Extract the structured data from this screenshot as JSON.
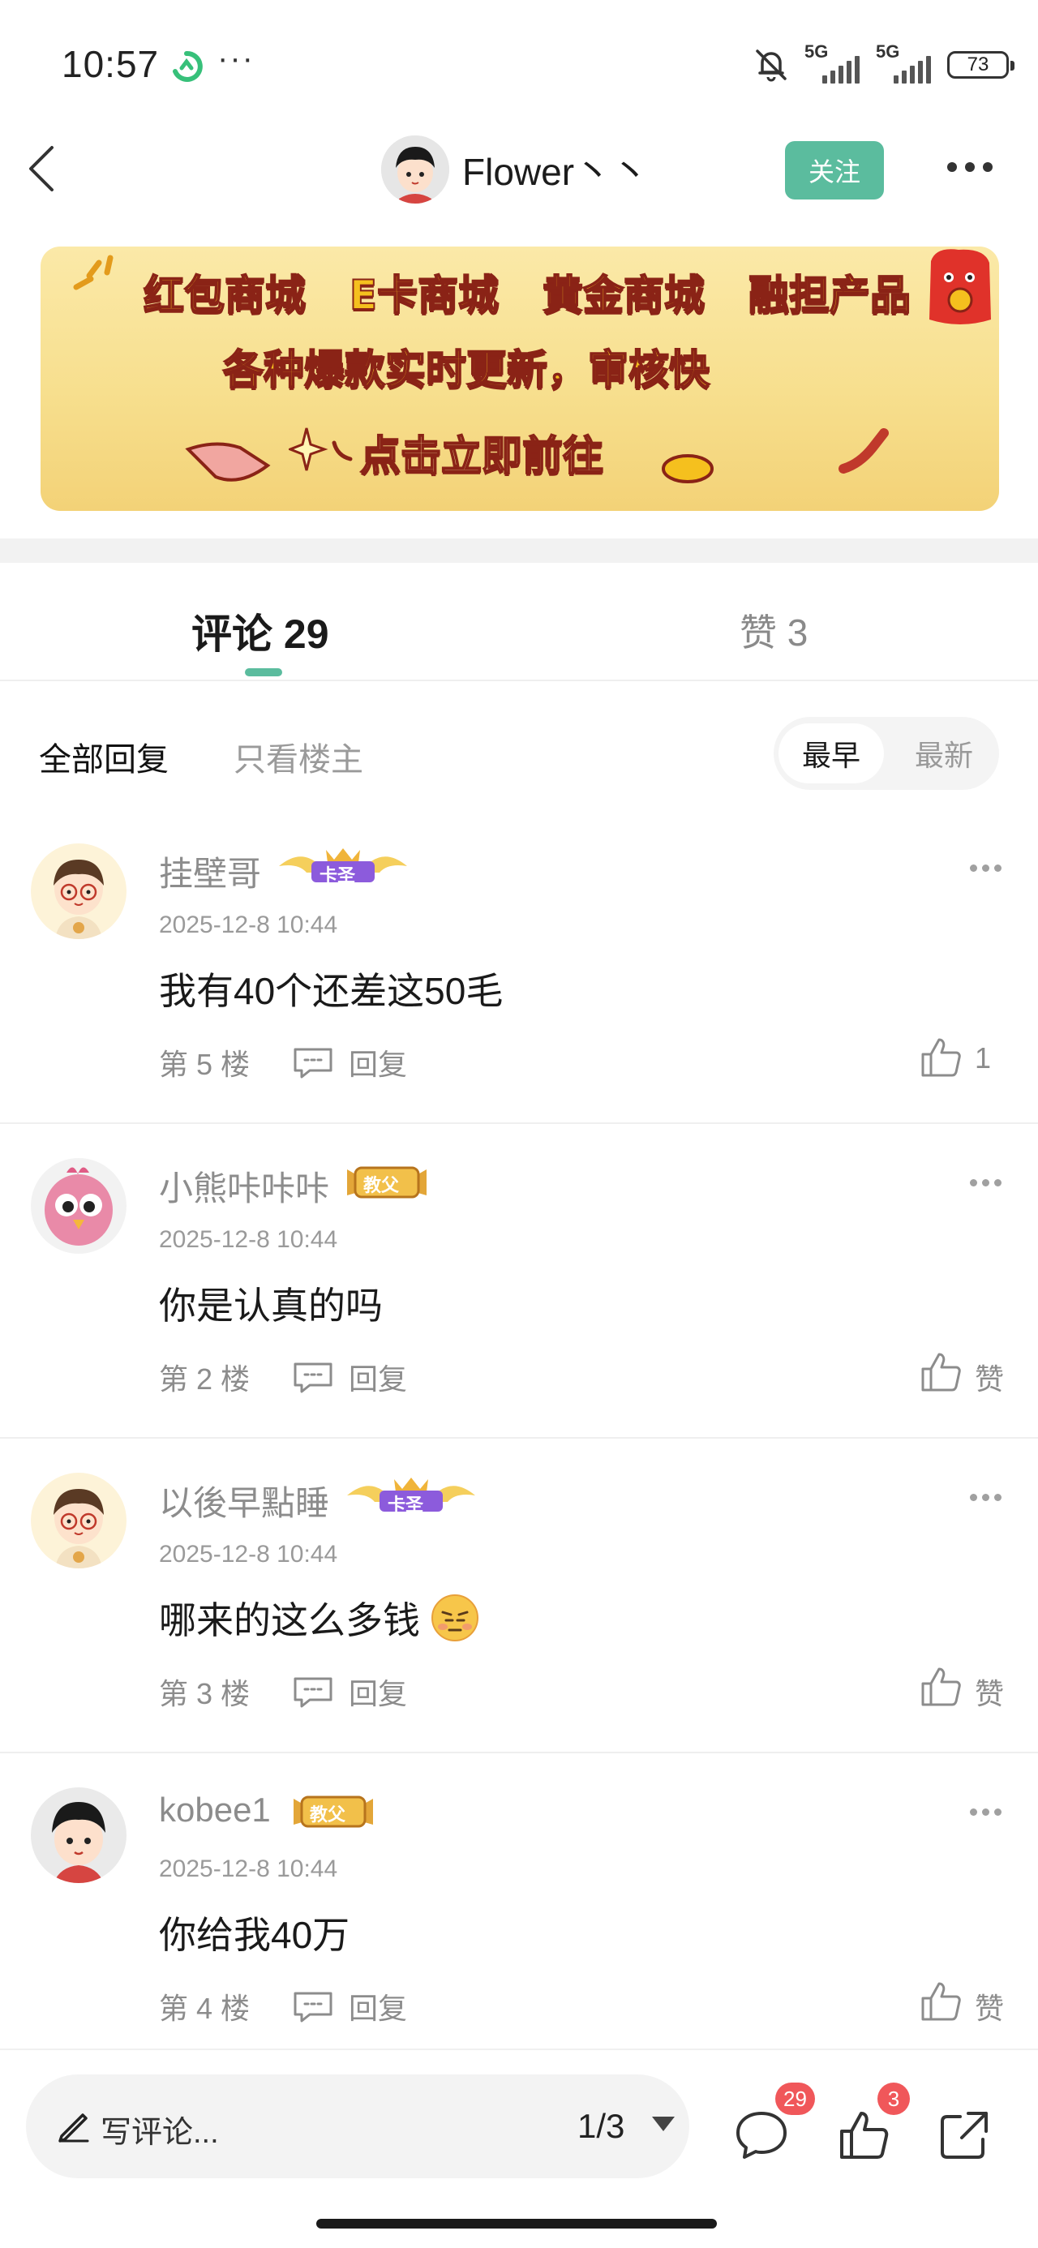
{
  "status_bar": {
    "time": "10:57",
    "dots": "···",
    "signal_1": "5G",
    "signal_2": "5G",
    "battery": "73"
  },
  "header": {
    "username": "Flower丶丶",
    "follow_label": "关注"
  },
  "banner": {
    "row1": [
      "红包商城",
      "E卡商城",
      "黄金商城",
      "融担产品"
    ],
    "row2": "各种爆款实时更新，审核快",
    "cta": "点击立即前往"
  },
  "tabs": {
    "comments_label": "评论 29",
    "likes_label": "赞 3"
  },
  "filter": {
    "all_label": "全部回复",
    "op_only_label": "只看楼主",
    "sort_early": "最早",
    "sort_new": "最新"
  },
  "comments": [
    {
      "name": "挂壁哥",
      "badge": "卡圣",
      "badge_style": "purple",
      "time": "2025-12-8 10:44",
      "text": "我有40个还差这50毛",
      "emoji": "",
      "floor": "第 5 楼",
      "reply": "回复",
      "like": "1",
      "avatar": "boy-glasses"
    },
    {
      "name": "小熊咔咔咔",
      "badge": "教父",
      "badge_style": "gold",
      "time": "2025-12-8 10:44",
      "text": "你是认真的吗",
      "emoji": "",
      "floor": "第 2 楼",
      "reply": "回复",
      "like": "赞",
      "avatar": "pink-bird"
    },
    {
      "name": "以後早點睡",
      "badge": "卡圣",
      "badge_style": "purple",
      "time": "2025-12-8 10:44",
      "text": "哪来的这么多钱",
      "emoji": "smirk-face-emoji",
      "floor": "第 3 楼",
      "reply": "回复",
      "like": "赞",
      "avatar": "boy-glasses"
    },
    {
      "name": "kobee1",
      "badge": "教父",
      "badge_style": "gold",
      "time": "2025-12-8 10:44",
      "text": "你给我40万",
      "emoji": "",
      "floor": "第 4 楼",
      "reply": "回复",
      "like": "赞",
      "avatar": "cartoon-kid"
    }
  ],
  "bottom_bar": {
    "write_placeholder": "写评论...",
    "page_indicator": "1/3",
    "comment_badge": "29",
    "like_badge": "3"
  },
  "colors": {
    "accent": "#5bbc9e",
    "badge_red": "#f0575a",
    "muted_text": "#8c8c8c"
  }
}
